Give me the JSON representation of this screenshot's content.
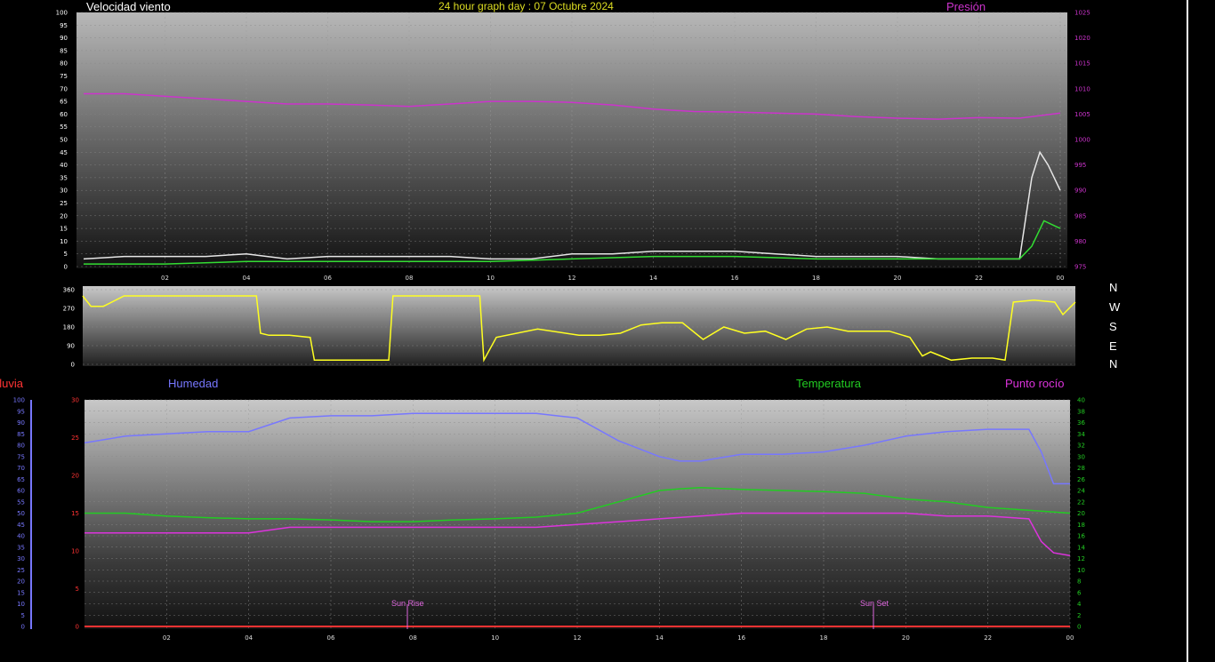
{
  "header": {
    "left_title": "Velocidad viento",
    "center_title": "24 hour graph day : 07 Octubre 2024",
    "right_title": "Presión"
  },
  "legend_bottom": {
    "rain": "Lluvia",
    "humidity": "Humedad",
    "temperature": "Temperatura",
    "dewpoint": "Punto rocío"
  },
  "direction_labels": [
    "N",
    "W",
    "S",
    "E",
    "N"
  ],
  "markers": {
    "sunrise_label": "Sun Rise",
    "sunset_label": "Sun Set"
  },
  "colors": {
    "wind_avg": "#e6e6e6",
    "wind_gust_green": "#33dd33",
    "pressure": "#cc33cc",
    "direction": "#ffff22",
    "humidity": "#7777ff",
    "temperature": "#22cc22",
    "dewpoint": "#dd33dd",
    "rain": "#ff3333"
  },
  "chart_data": [
    {
      "type": "line",
      "x_ticks": [
        "02",
        "04",
        "06",
        "08",
        "10",
        "12",
        "14",
        "16",
        "18",
        "20",
        "22",
        "00"
      ],
      "y_left_ticks": [
        0,
        5,
        10,
        15,
        20,
        25,
        30,
        35,
        40,
        45,
        50,
        55,
        60,
        65,
        70,
        75,
        80,
        85,
        90,
        95,
        100
      ],
      "y_right_ticks": [
        975,
        980,
        985,
        990,
        995,
        1000,
        1005,
        1010,
        1015,
        1020,
        1025
      ],
      "ylim_left": [
        0,
        100
      ],
      "ylim_right": [
        975,
        1025
      ],
      "series": [
        {
          "name": "Velocidad viento",
          "axis": "left",
          "x": [
            0,
            1,
            2,
            3,
            4,
            5,
            6,
            7,
            8,
            9,
            10,
            11,
            12,
            13,
            14,
            15,
            16,
            17,
            18,
            19,
            20,
            21,
            22,
            23,
            23.3,
            23.5,
            23.7,
            24
          ],
          "values": [
            3,
            4,
            4,
            4,
            5,
            3,
            4,
            4,
            4,
            4,
            3,
            3,
            5,
            5,
            6,
            6,
            6,
            5,
            4,
            4,
            4,
            3,
            3,
            3,
            35,
            45,
            40,
            30
          ]
        },
        {
          "name": "",
          "axis": "left",
          "x": [
            0,
            2,
            4,
            6,
            8,
            10,
            12,
            14,
            16,
            18,
            20,
            22,
            23,
            23.3,
            23.6,
            24
          ],
          "values": [
            1,
            1,
            2,
            2,
            2,
            2,
            3,
            4,
            4,
            3,
            3,
            3,
            3,
            8,
            18,
            15
          ]
        },
        {
          "name": "Presión",
          "axis": "right",
          "x": [
            0,
            1,
            2,
            3,
            4,
            5,
            6,
            7,
            8,
            9,
            10,
            11,
            12,
            13,
            14,
            15,
            16,
            17,
            18,
            19,
            20,
            21,
            22,
            23,
            24
          ],
          "values": [
            1009,
            1009,
            1008.5,
            1008,
            1007.5,
            1007,
            1007,
            1006.8,
            1006.5,
            1007,
            1007.5,
            1007.5,
            1007.3,
            1006.8,
            1006,
            1005.5,
            1005.4,
            1005.2,
            1005,
            1004.5,
            1004.2,
            1004,
            1004.3,
            1004.2,
            1005.2
          ]
        }
      ]
    },
    {
      "type": "line",
      "x_ticks": [],
      "y_ticks": [
        0,
        90,
        180,
        270,
        360
      ],
      "ylim": [
        0,
        360
      ],
      "series": [
        {
          "name": "",
          "x": [
            0,
            0.2,
            0.5,
            1,
            2,
            3,
            4.2,
            4.3,
            4.5,
            5,
            5.5,
            5.6,
            6.5,
            7,
            7.4,
            7.5,
            8,
            8.5,
            9,
            9.6,
            9.7,
            10,
            11,
            12,
            12.5,
            13,
            13.5,
            14,
            14.5,
            15,
            15.5,
            16,
            16.5,
            17,
            17.5,
            18,
            18.5,
            19,
            19.5,
            20,
            20.3,
            20.5,
            21,
            21.5,
            22,
            22.3,
            22.5,
            23,
            23.5,
            23.7,
            24
          ],
          "values": [
            330,
            280,
            280,
            330,
            330,
            330,
            330,
            150,
            140,
            140,
            130,
            20,
            20,
            20,
            20,
            330,
            330,
            330,
            330,
            330,
            20,
            130,
            170,
            140,
            140,
            150,
            190,
            200,
            200,
            120,
            180,
            150,
            160,
            120,
            170,
            180,
            160,
            160,
            160,
            130,
            40,
            60,
            20,
            30,
            30,
            20,
            300,
            310,
            300,
            240,
            300
          ]
        }
      ]
    },
    {
      "type": "line",
      "x_ticks": [
        "02",
        "04",
        "06",
        "08",
        "10",
        "12",
        "14",
        "16",
        "18",
        "20",
        "22",
        "00"
      ],
      "y_left_hum_ticks": [
        0,
        5,
        10,
        15,
        20,
        25,
        30,
        35,
        40,
        45,
        50,
        55,
        60,
        65,
        70,
        75,
        80,
        85,
        90,
        95,
        100
      ],
      "y_left_rain_ticks": [
        0,
        5,
        10,
        15,
        20,
        25,
        30
      ],
      "y_right_temp_ticks": [
        0,
        2,
        4,
        6,
        8,
        10,
        12,
        14,
        16,
        18,
        20,
        22,
        24,
        26,
        28,
        30,
        32,
        34,
        36,
        38,
        40
      ],
      "ylim_temp": [
        0,
        40
      ],
      "ylim_hum": [
        0,
        100
      ],
      "series": [
        {
          "name": "Humedad",
          "axis": "hum",
          "x": [
            0,
            1,
            2,
            3,
            4,
            5,
            6,
            7,
            8,
            9,
            10,
            11,
            12,
            13,
            14,
            14.5,
            15,
            16,
            17,
            18,
            19,
            20,
            21,
            22,
            23,
            23.3,
            23.6,
            24
          ],
          "values": [
            81,
            84,
            85,
            86,
            86,
            92,
            93,
            93,
            94,
            94,
            94,
            94,
            92,
            82,
            75,
            73,
            73,
            76,
            76,
            77,
            80,
            84,
            86,
            87,
            87,
            77,
            63,
            63
          ]
        },
        {
          "name": "Temperatura",
          "axis": "temp",
          "x": [
            0,
            1,
            2,
            3,
            4,
            5,
            6,
            7,
            8,
            9,
            10,
            11,
            12,
            13,
            14,
            14.5,
            15,
            16,
            17,
            18,
            19,
            20,
            21,
            22,
            23,
            24
          ],
          "values": [
            20,
            20,
            19.5,
            19.2,
            19,
            19,
            18.8,
            18.5,
            18.5,
            18.8,
            19,
            19.3,
            20,
            22,
            24,
            24.3,
            24.5,
            24.2,
            24,
            23.8,
            23.5,
            22.5,
            22,
            21,
            20.5,
            20
          ]
        },
        {
          "name": "Punto rocío",
          "axis": "temp",
          "x": [
            0,
            1,
            2,
            3,
            4,
            5,
            6,
            7,
            8,
            9,
            10,
            11,
            12,
            13,
            14,
            15,
            16,
            17,
            18,
            19,
            20,
            21,
            22,
            23,
            23.3,
            23.6,
            24
          ],
          "values": [
            16.5,
            16.5,
            16.5,
            16.5,
            16.5,
            17.5,
            17.5,
            17.5,
            17.5,
            17.5,
            17.5,
            17.5,
            18,
            18.5,
            19,
            19.5,
            20,
            20,
            20,
            20,
            20,
            19.5,
            19.5,
            19,
            15,
            13,
            12.5
          ]
        },
        {
          "name": "Lluvia",
          "axis": "rain",
          "x": [
            0,
            24
          ],
          "values": [
            0,
            0
          ]
        }
      ]
    }
  ]
}
